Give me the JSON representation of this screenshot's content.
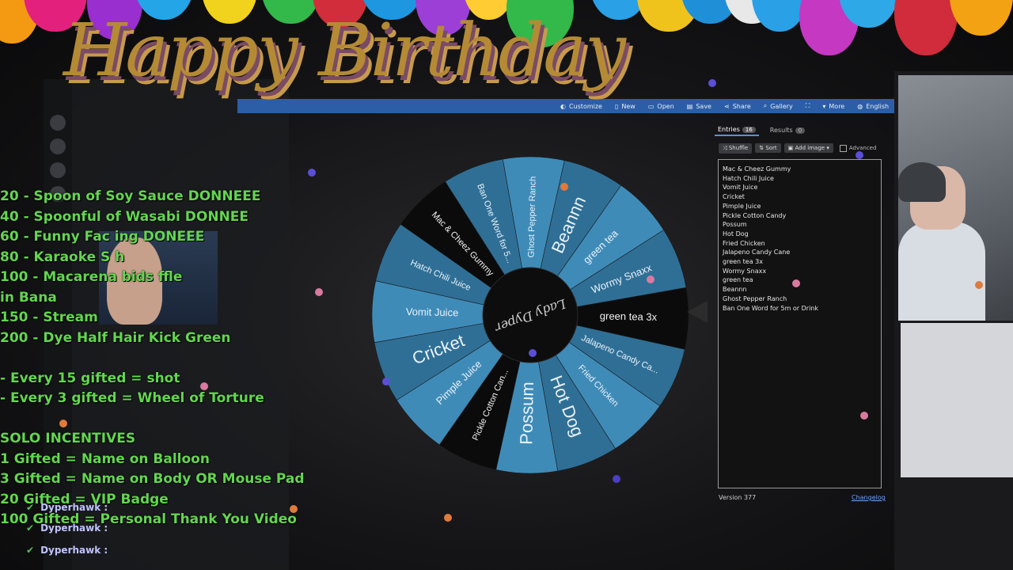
{
  "banner": {
    "title": "Happy Birthday"
  },
  "colors": {
    "incentive_text": "#63d64f",
    "wheel_blue": "#3a84b0",
    "wheel_black": "#0b0b0b",
    "banner_gold": "#b58a35"
  },
  "toolbar": {
    "items": [
      {
        "label": "Customize",
        "icon": "palette-icon"
      },
      {
        "label": "New",
        "icon": "new-file-icon"
      },
      {
        "label": "Open",
        "icon": "folder-icon"
      },
      {
        "label": "Save",
        "icon": "save-icon"
      },
      {
        "label": "Share",
        "icon": "share-icon"
      },
      {
        "label": "Gallery",
        "icon": "search-icon"
      },
      {
        "label": "",
        "icon": "fullscreen-icon"
      },
      {
        "label": "More",
        "icon": "chevron-down-icon"
      },
      {
        "label": "English",
        "icon": "globe-icon"
      }
    ]
  },
  "panel": {
    "tabs": [
      {
        "label": "Entries",
        "count": "16"
      },
      {
        "label": "Results",
        "count": "0"
      }
    ],
    "tools": {
      "shuffle": "Shuffle",
      "sort": "Sort",
      "add_image": "Add image",
      "advanced": "Advanced"
    },
    "entries": [
      "Mac & Cheez Gummy",
      "Hatch Chili Juice",
      "Vomit Juice",
      "Cricket",
      "Pimple Juice",
      "Pickle Cotton Candy",
      "Possum",
      "Hot Dog",
      "Fried Chicken",
      "Jalapeno Candy Cane",
      "green tea 3x",
      "Wormy Snaxx",
      "green tea",
      "Beannn",
      "Ghost Pepper Ranch",
      "Ban One Word for 5m or Drink"
    ],
    "version": "Version 377",
    "changelog": "Changelog"
  },
  "wheel": {
    "segments": [
      "Ghost Pepper Ranch",
      "Beannn",
      "green tea",
      "Wormy Snaxx",
      "green tea 3x",
      "Jalapeno Candy Ca...",
      "Fried Chicken",
      "Hot Dog",
      "Possum",
      "Pickle Cotton Can...",
      "Pimple Juice",
      "Cricket",
      "Vomit Juice",
      "Hatch Chili Juice",
      "Mac & Cheez Gummy",
      "Ban One Word for 5..."
    ],
    "center_logo": "Lady Dyper"
  },
  "incentives": [
    "20 - Spoon of Soy Sauce DONNEEE",
    "40 - Spoonful of Wasabi DONNEE",
    "60 - Funny Fac      ing DONEEE",
    "80 - Karaoke S          h",
    "100 - Macarena         bids    ffle",
    "         in Bana",
    "150 - Stream",
    "200 - Dye Half Hair Kick Green",
    "",
    "- Every 15 gifted = shot",
    "- Every 3 gifted = Wheel of Torture",
    "",
    "SOLO INCENTIVES",
    "1 Gifted = Name on Balloon",
    "3 Gifted = Name on Body OR Mouse Pad",
    "20 Gifted = VIP Badge",
    "100 Gifted = Personal Thank You Video"
  ],
  "chat": [
    {
      "user": "Dyperhawk :"
    },
    {
      "user": "Dyperhawk :"
    },
    {
      "user": "Dyperhawk :"
    }
  ]
}
